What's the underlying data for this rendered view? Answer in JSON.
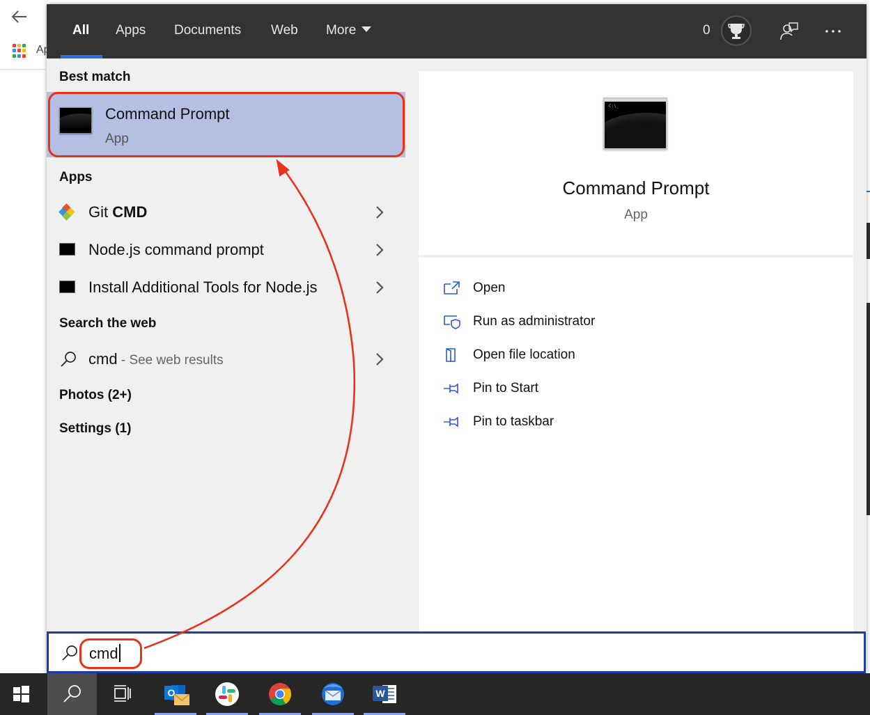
{
  "background_browser": {
    "apps_label": "Ap"
  },
  "header": {
    "tabs": [
      {
        "label": "All",
        "active": true
      },
      {
        "label": "Apps"
      },
      {
        "label": "Documents"
      },
      {
        "label": "Web"
      },
      {
        "label": "More"
      }
    ],
    "reward_count": "0",
    "icons": [
      "trophy-icon",
      "feedback-icon",
      "more-options-icon"
    ]
  },
  "results": {
    "best_match_header": "Best match",
    "best_match": {
      "title": "Command Prompt",
      "subtitle": "App"
    },
    "apps_header": "Apps",
    "apps": [
      {
        "prefix": "Git ",
        "bold": "CMD",
        "icon": "git-icon"
      },
      {
        "prefix": "Node.js command prompt",
        "bold": "",
        "icon": "console-icon"
      },
      {
        "prefix": "Install Additional Tools for Node.js",
        "bold": "",
        "icon": "console-icon"
      }
    ],
    "web_header": "Search the web",
    "web_result": {
      "query": "cmd",
      "suffix": " - See web results"
    },
    "photos": "Photos (2+)",
    "settings": "Settings (1)"
  },
  "preview": {
    "title": "Command Prompt",
    "subtitle": "App",
    "icon_text": "C:\\_",
    "actions": [
      {
        "label": "Open",
        "icon": "open-icon"
      },
      {
        "label": "Run as administrator",
        "icon": "admin-shield-icon"
      },
      {
        "label": "Open file location",
        "icon": "file-location-icon"
      },
      {
        "label": "Pin to Start",
        "icon": "pin-icon"
      },
      {
        "label": "Pin to taskbar",
        "icon": "pin-icon"
      }
    ]
  },
  "search_box": {
    "value": "cmd"
  },
  "taskbar": {
    "items": [
      "windows-start-icon",
      "search-icon",
      "task-view-icon",
      "outlook-icon",
      "slack-icon",
      "chrome-icon",
      "thunderbird-icon",
      "word-icon"
    ]
  },
  "colors": {
    "accent": "#2d6fe0",
    "highlight": "#b5bee3",
    "annotation": "#e8321a",
    "topbar": "#333333",
    "taskbar": "#262626"
  }
}
